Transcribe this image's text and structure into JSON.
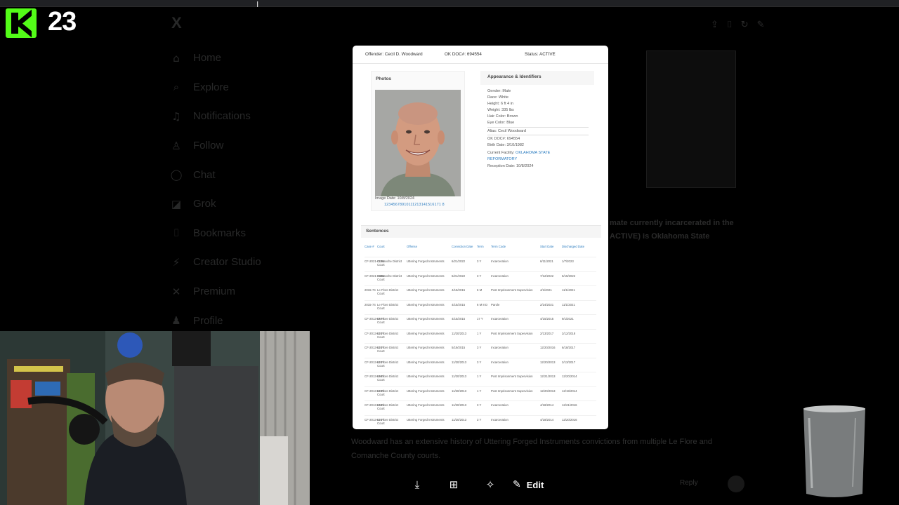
{
  "stream": {
    "kick_count": "23"
  },
  "sidebar": {
    "logo": "X",
    "items": [
      {
        "label": "Home",
        "icon": "home-icon",
        "glyph": "⌂"
      },
      {
        "label": "Explore",
        "icon": "search-icon",
        "glyph": "⌕"
      },
      {
        "label": "Notifications",
        "icon": "bell-icon",
        "glyph": "♫"
      },
      {
        "label": "Follow",
        "icon": "follow-icon",
        "glyph": "♙"
      },
      {
        "label": "Chat",
        "icon": "chat-icon",
        "glyph": "◯"
      },
      {
        "label": "Grok",
        "icon": "grok-icon",
        "glyph": "◪"
      },
      {
        "label": "Bookmarks",
        "icon": "bookmark-icon",
        "glyph": "⌷"
      },
      {
        "label": "Creator Studio",
        "icon": "creator-icon",
        "glyph": "⚡"
      },
      {
        "label": "Premium",
        "icon": "premium-icon",
        "glyph": "✕"
      },
      {
        "label": "Profile",
        "icon": "profile-icon",
        "glyph": "♟"
      }
    ]
  },
  "background_post": {
    "text_a": "mate currently incarcerated in the ACTIVE) is Oklahoma State",
    "text_b": "Woodward has an extensive history of Uttering Forged Instruments convictions from multiple Le Flore and Comanche County courts.",
    "reply_label": "Reply"
  },
  "document": {
    "header": {
      "offender": "Offender: Cecil D. Woodward",
      "doc": "OK DOC#: 694554",
      "status": "Status: ACTIVE"
    },
    "photos": {
      "title": "Photos",
      "image_date": "Image Date: 10/8/2024",
      "pager": "12345678910111213141516171 8"
    },
    "appearance": {
      "title": "Appearance & Identifiers",
      "gender": "Gender: Male",
      "race": "Race: White",
      "height": "Height: 6 ft 4 in",
      "weight": "Weight: 335 lbs",
      "hair": "Hair Color: Brown",
      "eye": "Eye Color: Blue",
      "alias": "Alias: Cecil Woodward",
      "doc_no": "OK DOC#: 694554",
      "birth": "Birth Date: 3/10/1982",
      "facility_label": "Current Facility:",
      "facility_link_1": "OKLAHOMA STATE",
      "facility_link_2": "REFORMATORY",
      "reception": "Reception Date: 10/8/2024"
    },
    "sentences": {
      "title": "Sentences",
      "headers": [
        "Case #",
        "Court",
        "Offense",
        "Conviction Date",
        "Term",
        "Term Code",
        "Start Date",
        "Discharged Date"
      ],
      "rows": [
        [
          "CF-2021-0155",
          "Comanche District Court",
          "Uttering Forged Instruments",
          "6/21/2022",
          "3 Y",
          "Incarceration",
          "6/11/2021",
          "1/7/2023"
        ],
        [
          "CF-2021-0055",
          "Comanche District Court",
          "Uttering Forged Instruments",
          "6/21/2022",
          "3 Y",
          "Incarceration",
          "7/12/2022",
          "6/15/2022"
        ],
        [
          "2015-74",
          "Le Flore District Court",
          "Uttering Forged Instruments",
          "4/15/2015",
          "6 M",
          "Post Imprisonment Supervision",
          "4/1/2021",
          "11/1/2021"
        ],
        [
          "2015-74",
          "Le Flore District Court",
          "Uttering Forged Instruments",
          "4/15/2015",
          "6 M 8 D",
          "Parole",
          "2/24/2021",
          "11/1/2021"
        ],
        [
          "CF-2013-0574",
          "Le Flore District Court",
          "Uttering Forged Instruments",
          "4/15/2015",
          "17 Y",
          "Incarceration",
          "4/15/2015",
          "9/1/2021"
        ],
        [
          "CF-2013-0217",
          "Le Flore District Court",
          "Uttering Forged Instruments",
          "11/20/2013",
          "1 Y",
          "Post Imprisonment Supervision",
          "2/13/2017",
          "2/12/2018"
        ],
        [
          "CF-2013-0217",
          "Le Flore District Court",
          "Uttering Forged Instruments",
          "5/19/2015",
          "3 Y",
          "Incarceration",
          "12/20/2016",
          "6/18/2017"
        ],
        [
          "CF-2013-0217",
          "Le Flore District Court",
          "Uttering Forged Instruments",
          "11/20/2013",
          "3 Y",
          "Incarceration",
          "12/20/2013",
          "2/13/2017"
        ],
        [
          "CF-2013-0662",
          "Le Flore District Court",
          "Uttering Forged Instruments",
          "11/20/2013",
          "1 Y",
          "Post Imprisonment Supervision",
          "12/21/2013",
          "12/20/2014"
        ],
        [
          "CF-2013-0228",
          "Le Flore District Court",
          "Uttering Forged Instruments",
          "11/20/2013",
          "1 Y",
          "Post Imprisonment Supervision",
          "12/20/2013",
          "12/19/2014"
        ],
        [
          "CF-2013-0662",
          "Le Flore District Court",
          "Uttering Forged Instruments",
          "11/20/2013",
          "3 Y",
          "Incarceration",
          "4/18/2014",
          "12/21/2016"
        ],
        [
          "CF-2013-0217",
          "Le Flore District Court",
          "Uttering Forged Instruments",
          "11/20/2013",
          "3 Y",
          "Incarceration",
          "4/18/2014",
          "12/20/2016"
        ]
      ]
    }
  },
  "toolbar": {
    "edit_label": "Edit"
  }
}
